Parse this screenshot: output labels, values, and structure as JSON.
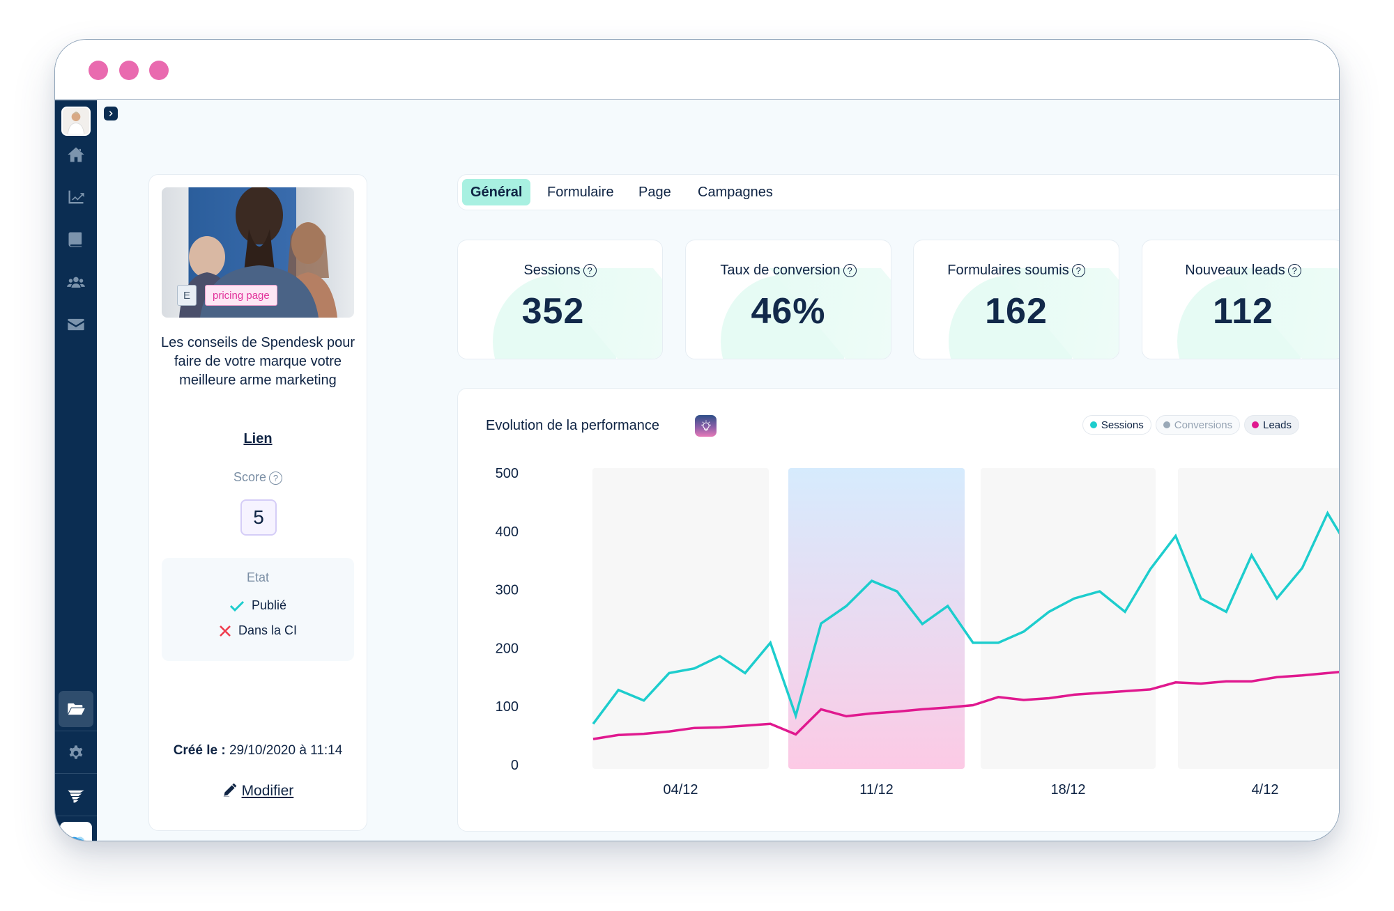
{
  "window": {
    "dot_color": "#e96aaf",
    "dots": [
      "close",
      "minimize",
      "maximize"
    ]
  },
  "sidebar": {
    "avatar": "user-avatar",
    "collapse_icon": "chevron-right-icon",
    "items": [
      {
        "name": "home",
        "icon": "home-icon"
      },
      {
        "name": "analytics",
        "icon": "chart-line-icon"
      },
      {
        "name": "content",
        "icon": "book-icon"
      },
      {
        "name": "contacts",
        "icon": "users-icon"
      },
      {
        "name": "emails",
        "icon": "envelope-icon"
      }
    ],
    "bottom_items": [
      {
        "name": "files",
        "icon": "folder-open-icon",
        "active": true
      },
      {
        "name": "settings",
        "icon": "gear-icon"
      },
      {
        "name": "integration",
        "icon": "tornado-logo-icon"
      },
      {
        "name": "workspace",
        "icon": "wave-logo-icon"
      }
    ]
  },
  "article": {
    "tag_letter": "E",
    "tag_label": "pricing page",
    "title": "Les conseils de Spendesk pour faire de votre marque votre meilleure arme marketing",
    "link_label": "Lien",
    "score_label": "Score",
    "score_value": "5",
    "etat_label": "Etat",
    "status": [
      {
        "label": "Publié",
        "ok": true
      },
      {
        "label": "Dans la CI",
        "ok": false
      }
    ],
    "created_label": "Créé le :",
    "created_value": "29/10/2020 à 11:14",
    "modify_label": "Modifier"
  },
  "tabs": [
    {
      "label": "Général",
      "active": true
    },
    {
      "label": "Formulaire",
      "active": false
    },
    {
      "label": "Page",
      "active": false
    },
    {
      "label": "Campagnes",
      "active": false
    }
  ],
  "kpis": [
    {
      "label": "Sessions",
      "value": "352"
    },
    {
      "label": "Taux de conversion",
      "value": "46%"
    },
    {
      "label": "Formulaires soumis",
      "value": "162"
    },
    {
      "label": "Nouveaux leads",
      "value": "112"
    }
  ],
  "chart_panel": {
    "title": "Evolution de la performance",
    "insight_icon": "lightbulb-icon"
  },
  "chart_data": {
    "type": "line",
    "title": "Evolution de la performance",
    "xlabel": "",
    "ylabel": "",
    "ylim": [
      0,
      500
    ],
    "yticks": [
      0,
      100,
      200,
      300,
      400,
      500
    ],
    "grid": false,
    "legend_position": "top-right",
    "week_labels": [
      "04/12",
      "11/12",
      "18/12",
      "4/12"
    ],
    "highlighted_week": 1,
    "points_per_chart": 31,
    "series": [
      {
        "name": "Sessions",
        "color": "#1dcdcd",
        "visible": true,
        "values": [
          70,
          128,
          110,
          157,
          165,
          186,
          157,
          209,
          84,
          242,
          272,
          315,
          297,
          241,
          272,
          209,
          209,
          228,
          262,
          285,
          297,
          262,
          335,
          392,
          285,
          262,
          359,
          285,
          337,
          431,
          359
        ]
      },
      {
        "name": "Conversions",
        "color": "#9aa9b8",
        "visible": false,
        "values": []
      },
      {
        "name": "Leads",
        "color": "#e0198f",
        "visible": true,
        "values": [
          44,
          51,
          53,
          57,
          63,
          64,
          67,
          70,
          52,
          95,
          83,
          88,
          91,
          95,
          98,
          102,
          116,
          111,
          114,
          120,
          123,
          126,
          129,
          141,
          139,
          143,
          143,
          150,
          153,
          157,
          161
        ]
      }
    ]
  }
}
